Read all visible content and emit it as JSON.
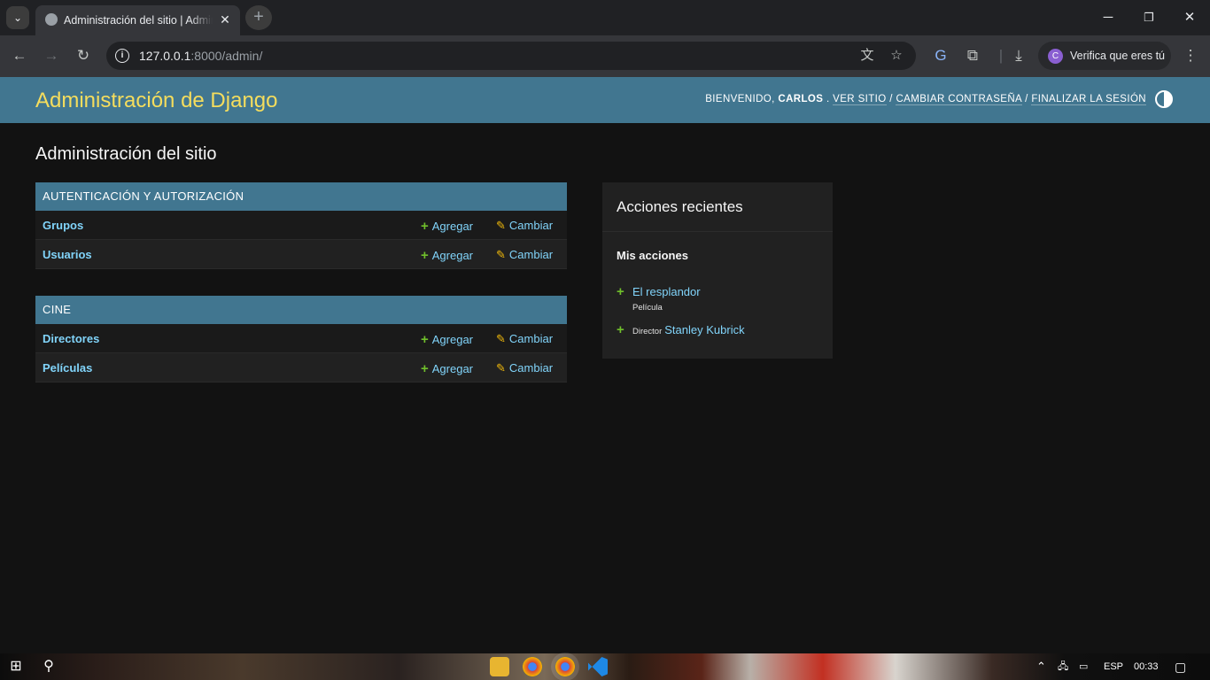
{
  "browser": {
    "tab_title": "Administración del sitio | Administración de Django",
    "new_tab_label": "+",
    "url_host": "127.0.0.1",
    "url_rest": ":8000/admin/",
    "profile_label": "Verifica que eres tú",
    "profile_initial": "C"
  },
  "header": {
    "branding": "Administración de Django",
    "welcome": "BIENVENIDO,",
    "username": "CARLOS",
    "separator_dot": ".",
    "view_site": "VER SITIO",
    "change_password": "CAMBIAR CONTRASEÑA",
    "logout": "FINALIZAR LA SESIÓN",
    "slash": "/"
  },
  "page_title": "Administración del sitio",
  "apps": [
    {
      "caption": "AUTENTICACIÓN Y AUTORIZACIÓN",
      "models": [
        {
          "name": "Grupos",
          "add": "Agregar",
          "change": "Cambiar"
        },
        {
          "name": "Usuarios",
          "add": "Agregar",
          "change": "Cambiar"
        }
      ]
    },
    {
      "caption": "CINE",
      "models": [
        {
          "name": "Directores",
          "add": "Agregar",
          "change": "Cambiar"
        },
        {
          "name": "Películas",
          "add": "Agregar",
          "change": "Cambiar"
        }
      ]
    }
  ],
  "recent_actions": {
    "title": "Acciones recientes",
    "subtitle": "Mis acciones",
    "items": [
      {
        "object": "El resplandor",
        "content_type": "Película"
      },
      {
        "object": "Stanley Kubrick",
        "content_type": "Director"
      }
    ]
  },
  "taskbar": {
    "language": "ESP",
    "time": "00:33"
  },
  "icons": {
    "add": "plus-icon",
    "change": "pencil-icon"
  },
  "colors": {
    "header_bg": "#417690",
    "branding": "#f5dd5d",
    "link": "#81d4fa",
    "add_icon": "#70bf2b",
    "change_icon": "#efb80b",
    "page_bg": "#121212"
  }
}
